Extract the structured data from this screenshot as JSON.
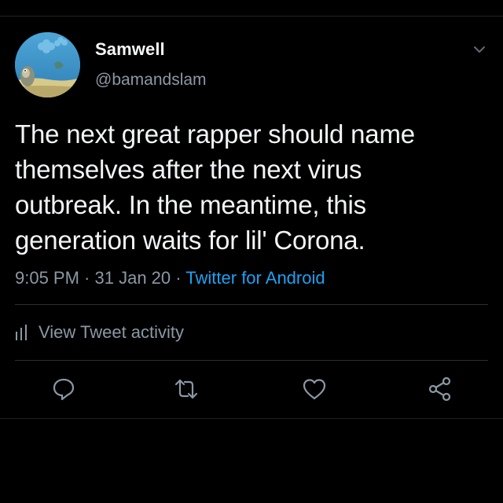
{
  "author": {
    "display_name": "Samwell",
    "handle": "@bamandslam"
  },
  "tweet": {
    "text": "The next great rapper should name\nthemselves after the next virus\noutbreak. In the meantime, this\ngeneration waits for lil' Corona.",
    "time": "9:05 PM",
    "date": "31 Jan 20",
    "source": "Twitter for Android",
    "separator": " · "
  },
  "activity": {
    "label": "View Tweet activity"
  },
  "actions": {
    "icons": [
      "reply-icon",
      "retweet-icon",
      "like-icon",
      "share-icon"
    ]
  },
  "colors": {
    "background": "#000000",
    "text": "#f2f4f6",
    "secondary": "#8b98a5",
    "accent": "#1da1f2"
  }
}
